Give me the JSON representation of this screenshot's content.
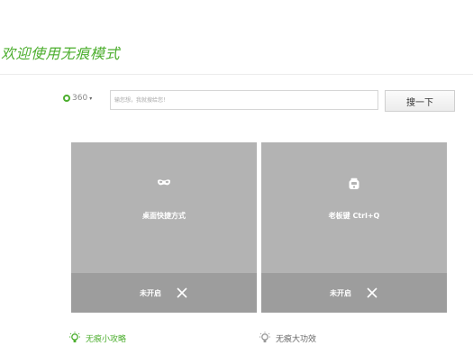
{
  "header": {
    "title": "欢迎使用无痕模式"
  },
  "search": {
    "engine_icon": "circle-q-logo",
    "engine_label": "360",
    "engine_caret": "▾",
    "placeholder": "输您想，我就搜给您！",
    "button_label": "搜一下"
  },
  "cards": [
    {
      "icon": "mask-icon",
      "label": "桌面快捷方式",
      "status": "未开启",
      "close_icon": "close-icon"
    },
    {
      "icon": "boss-key-icon",
      "label": "老板键 Ctrl+Q",
      "status": "未开启",
      "close_icon": "close-icon"
    }
  ],
  "tips": [
    {
      "icon": "lightbulb-icon",
      "label": "无痕小攻略",
      "color": "#4cae2e"
    },
    {
      "icon": "lightbulb-icon",
      "label": "无痕大功效",
      "color": "#666666"
    }
  ],
  "colors": {
    "accent": "#4cae2e",
    "card_bg": "#b3b3b3",
    "card_footer_bg": "#9d9d9d"
  }
}
